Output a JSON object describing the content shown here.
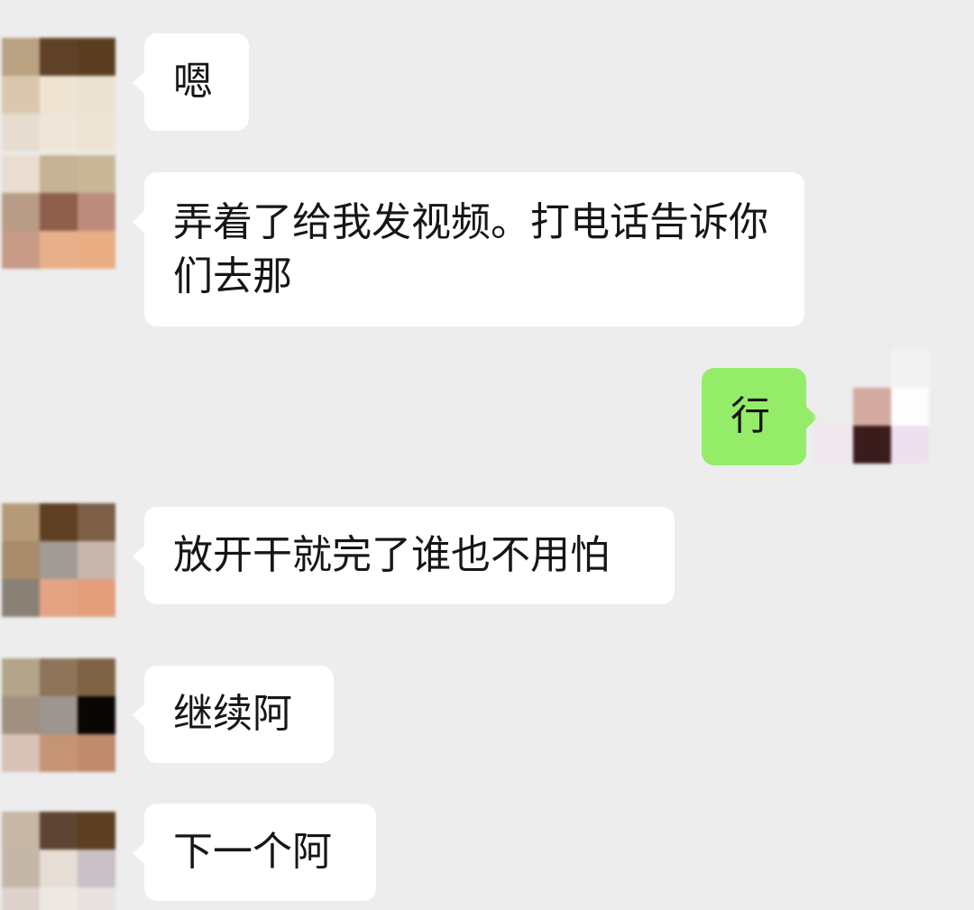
{
  "chat": {
    "messages": [
      {
        "side": "left",
        "text": "嗯",
        "avatar_colors": [
          "#b8a282",
          "#5e4126",
          "#5b3e20",
          "#d9c8ae",
          "#efe4d2",
          "#ece2d2",
          "#e6ddd0",
          "#efe6da",
          "#ede4d6"
        ]
      },
      {
        "side": "left",
        "text": "弄着了给我发视频。打电话告诉你们去那",
        "avatar_colors": [
          "#e8ddd0",
          "#c6b294",
          "#c8b898",
          "#b89c86",
          "#8f5e4c",
          "#bd8c7c",
          "#c79a86",
          "#e8b08a",
          "#e9ad84"
        ]
      },
      {
        "side": "right",
        "text": "行",
        "avatar_colors": [
          "#ececec",
          "#ececec",
          "#f2f2f2",
          "#ececec",
          "#d3aaa0",
          "#fdfdfd",
          "#f0e6ee",
          "#3b1c1d",
          "#eee0ee"
        ]
      },
      {
        "side": "left",
        "text": "放开干就完了谁也不用怕",
        "avatar_colors": [
          "#b59a78",
          "#5f3f22",
          "#7c5f46",
          "#a88b6a",
          "#a29a94",
          "#c8b6ac",
          "#8a8176",
          "#e4a484",
          "#e39d7a"
        ]
      },
      {
        "side": "left",
        "text": "继续阿",
        "avatar_colors": [
          "#b3a48a",
          "#8e7458",
          "#7e6244",
          "#a09080",
          "#9c9590",
          "#0a0606",
          "#d8c2b8",
          "#c49474",
          "#c08a6c"
        ]
      },
      {
        "side": "left",
        "text": "下一个阿",
        "avatar_colors": [
          "#c8b6a6",
          "#5e4432",
          "#5c3e20",
          "#c4b6a8",
          "#e6ddd4",
          "#c8c0c6",
          "#ddd3cc",
          "#ede8e2",
          "#e8e2e0"
        ]
      }
    ]
  },
  "colors": {
    "background": "#ededed",
    "bubble_incoming": "#ffffff",
    "bubble_outgoing": "#95ec69",
    "text": "#161616"
  }
}
